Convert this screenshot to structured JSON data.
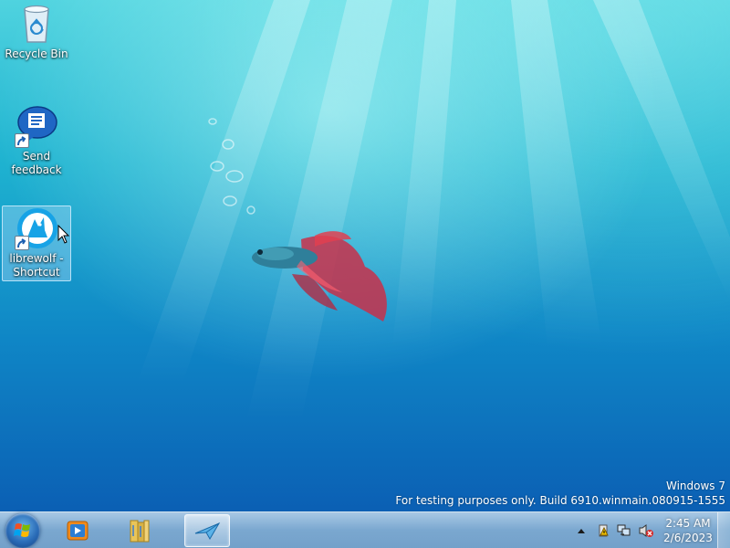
{
  "desktop": {
    "icons": [
      {
        "label": "Recycle Bin",
        "icon": "recycle-bin-icon",
        "selected": false
      },
      {
        "label": "Send\nfeedback",
        "icon": "send-feedback-icon",
        "shortcut": true,
        "selected": false
      },
      {
        "label": "librewolf -\nShortcut",
        "icon": "librewolf-icon",
        "shortcut": true,
        "selected": true
      }
    ],
    "watermark": {
      "line1": "Windows  7",
      "line2": "For testing purposes only. Build 6910.winmain.080915-1555"
    }
  },
  "taskbar": {
    "start_icon": "windows-start-orb",
    "pinned": [
      {
        "icon": "media-player-icon",
        "active": false
      },
      {
        "icon": "libraries-folder-icon",
        "active": false
      },
      {
        "icon": "feedback-tool-icon",
        "active": true
      }
    ],
    "tray": {
      "icons": [
        "show-hidden-icons-arrow",
        "action-center-warning-icon",
        "network-icon",
        "volume-muted-icon"
      ],
      "time": "2:45 AM",
      "date": "2/6/2023"
    }
  },
  "colors": {
    "wallpaper_top": "#4fd3df",
    "wallpaper_bottom": "#0a57b0",
    "fish_body": "#2f7f9a",
    "fish_fins": "#d0304a"
  }
}
